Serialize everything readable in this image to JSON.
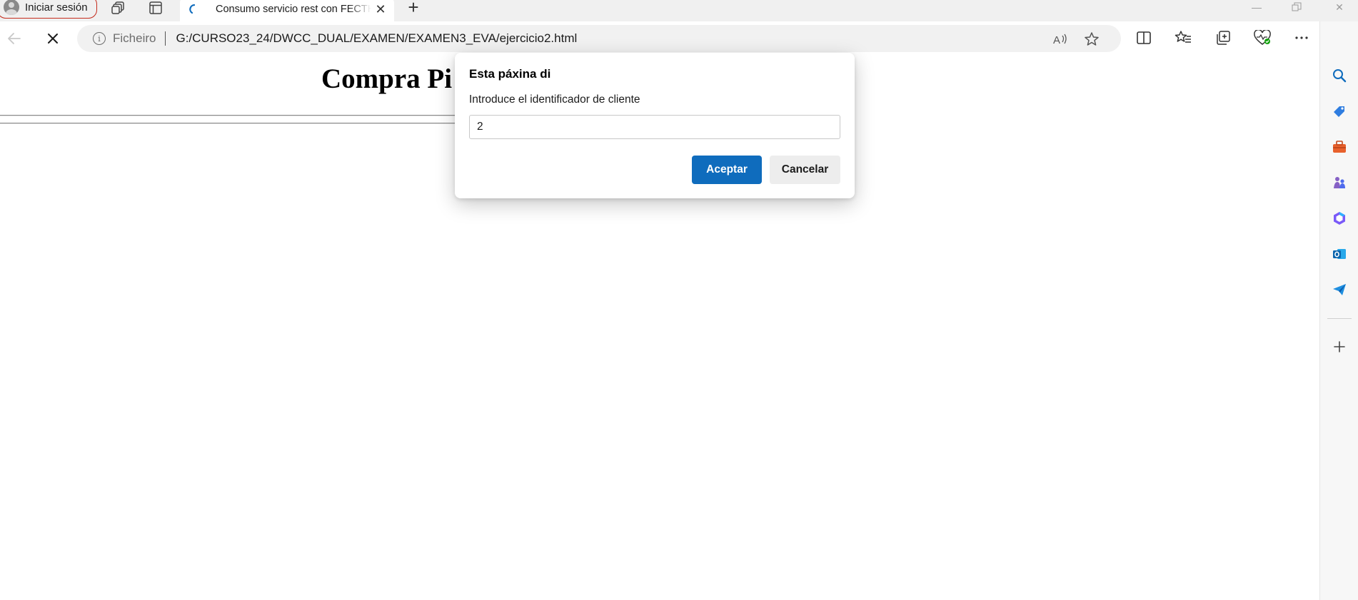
{
  "browser": {
    "profile_label": "Iniciar sesión",
    "tab": {
      "title": "Consumo servicio rest con FECTH",
      "favicon": "loading-spinner-icon"
    },
    "address": {
      "scheme_label": "Ficheiro",
      "url": "G:/CURSO23_24/DWCC_DUAL/EXAMEN/EXAMEN3_EVA/ejercicio2.html"
    },
    "colors": {
      "profile_border": "#c42b1c",
      "accent": "#0f6cbd"
    }
  },
  "page": {
    "title": "Compra Pi"
  },
  "dialog": {
    "heading": "Esta páxina di",
    "message": "Introduce el identificador de cliente",
    "input_value": "2",
    "ok_label": "Aceptar",
    "cancel_label": "Cancelar"
  },
  "sidebar": {
    "items": [
      "search-icon",
      "tag-icon",
      "toolbox-icon",
      "games-icon",
      "office-icon",
      "outlook-icon",
      "send-icon",
      "add-icon"
    ]
  }
}
